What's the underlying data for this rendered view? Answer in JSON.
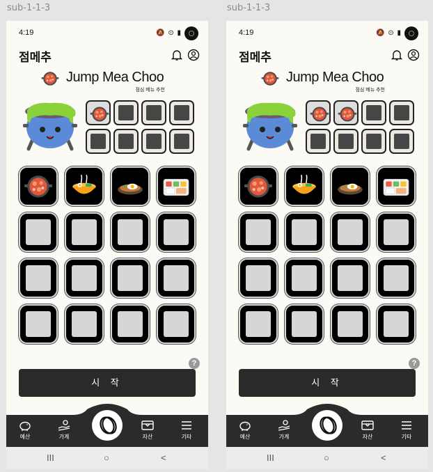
{
  "frames": [
    {
      "label": "sub-1-1-3",
      "filled_mini_slots": 1
    },
    {
      "label": "sub-1-1-3",
      "filled_mini_slots": 2
    }
  ],
  "status": {
    "time": "4:19",
    "icons": "🔕 ⊙ ▮"
  },
  "app": {
    "title": "점메추",
    "bell_icon": "bell-icon",
    "profile_icon": "user-circle-icon"
  },
  "brand": {
    "name": "Jump Mea Choo",
    "subtitle": "점심 메뉴 추천"
  },
  "menu_items": [
    {
      "name": "tteokbokki",
      "icon": "hotpot-icon"
    },
    {
      "name": "ramen",
      "icon": "noodle-bowl-icon"
    },
    {
      "name": "fried-egg-rice",
      "icon": "egg-plate-icon"
    },
    {
      "name": "lunchbox",
      "icon": "lunchbox-icon"
    }
  ],
  "help_label": "?",
  "start_button": "시 작",
  "tabs": [
    {
      "label": "예산",
      "icon": "piggy-bank-icon"
    },
    {
      "label": "가계",
      "icon": "hand-coin-icon"
    },
    {
      "label": "자산",
      "icon": "wallet-icon"
    },
    {
      "label": "기타",
      "icon": "menu-icon"
    }
  ],
  "center_tab_icon": "coin-icon",
  "nav": {
    "recent": "III",
    "home": "○",
    "back": "<"
  }
}
